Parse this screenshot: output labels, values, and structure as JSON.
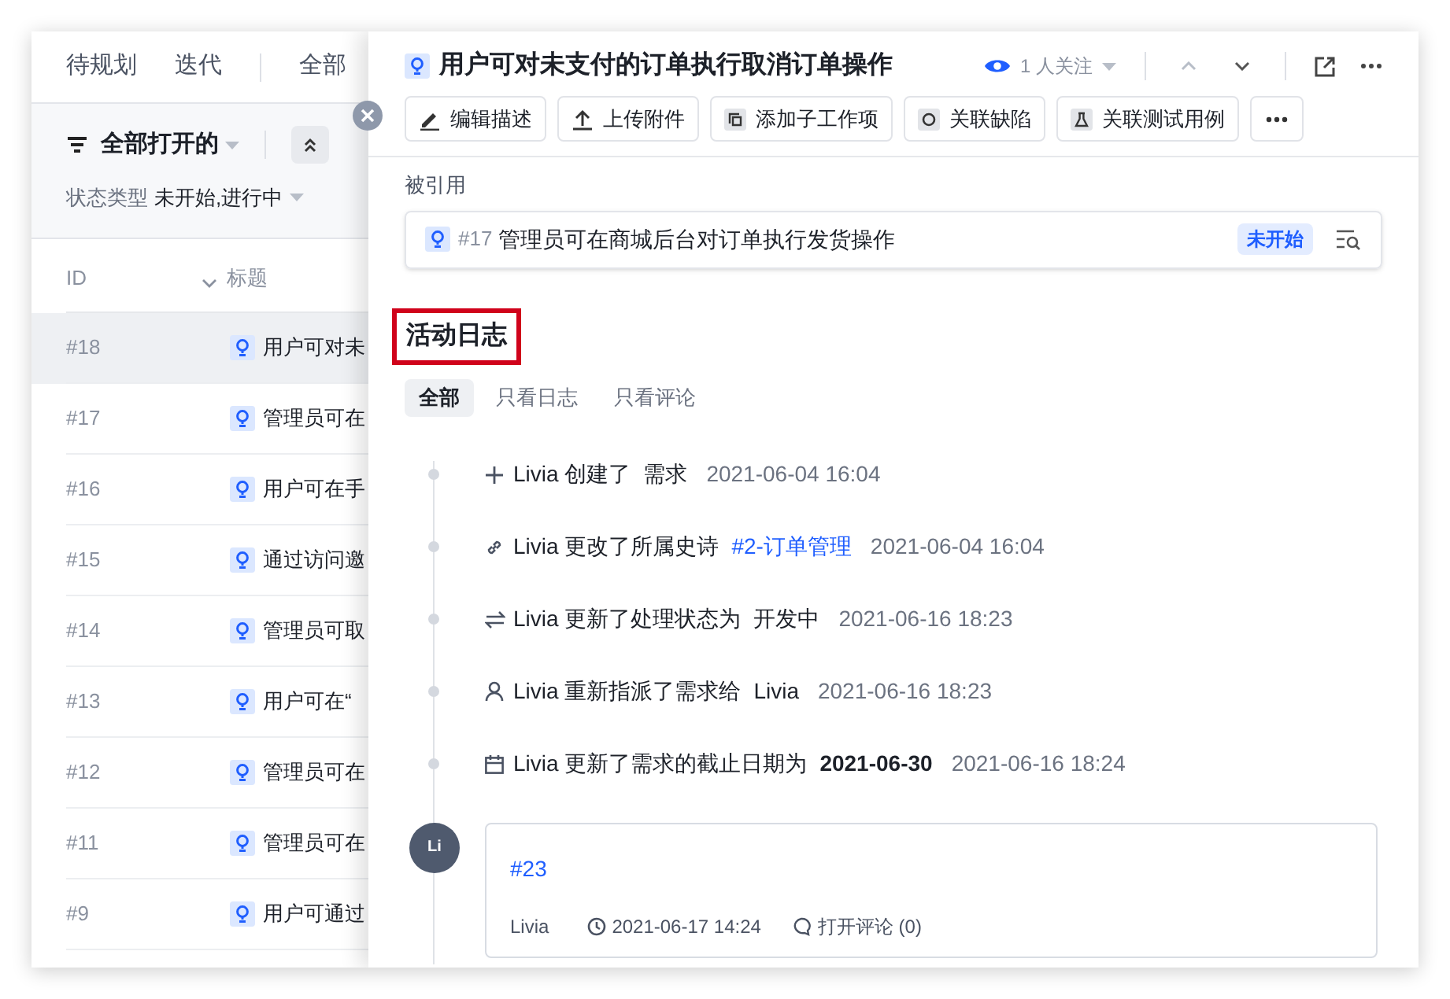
{
  "list_panel": {
    "nav_tabs": [
      "待规划",
      "迭代",
      "全部"
    ],
    "filter": {
      "title": "全部打开的",
      "fields": [
        {
          "label": "状态类型",
          "value": "未开始,进行中"
        }
      ]
    },
    "columns": [
      "ID",
      "标题"
    ],
    "rows": [
      {
        "id": "#18",
        "title": "用户可对未",
        "selected": true
      },
      {
        "id": "#17",
        "title": "管理员可在",
        "selected": false
      },
      {
        "id": "#16",
        "title": "用户可在手",
        "selected": false
      },
      {
        "id": "#15",
        "title": "通过访问邀",
        "selected": false
      },
      {
        "id": "#14",
        "title": "管理员可取",
        "selected": false
      },
      {
        "id": "#13",
        "title": "用户可在“",
        "selected": false
      },
      {
        "id": "#12",
        "title": "管理员可在",
        "selected": false
      },
      {
        "id": "#11",
        "title": "管理员可在",
        "selected": false
      },
      {
        "id": "#9",
        "title": "用户可通过",
        "selected": false
      }
    ]
  },
  "drawer": {
    "title": "用户可对未支付的订单执行取消订单操作",
    "followers": "1 人关注",
    "actions": [
      {
        "kind": "edit",
        "label": "编辑描述"
      },
      {
        "kind": "upload",
        "label": "上传附件"
      },
      {
        "kind": "child",
        "label": "添加子工作项"
      },
      {
        "kind": "bug",
        "label": "关联缺陷"
      },
      {
        "kind": "test",
        "label": "关联测试用例"
      },
      {
        "kind": "more"
      }
    ],
    "references": {
      "label": "被引用",
      "items": [
        {
          "id": "#17",
          "title": "管理员可在商城后台对订单执行发货操作",
          "status": "未开始"
        }
      ]
    },
    "activity": {
      "heading": "活动日志",
      "tabs": [
        {
          "label": "全部",
          "selected": true
        },
        {
          "label": "只看日志",
          "selected": false
        },
        {
          "label": "只看评论",
          "selected": false
        }
      ],
      "entries": [
        {
          "kind": "create",
          "actor": "Livia",
          "action": "创建了",
          "target": "需求",
          "time": "2021-06-04 16:04"
        },
        {
          "kind": "link",
          "actor": "Livia",
          "action": "更改了所属史诗",
          "target": "#2-订单管理",
          "time": "2021-06-04 16:04"
        },
        {
          "kind": "status",
          "actor": "Livia",
          "action": "更新了处理状态为",
          "target": "开发中",
          "time": "2021-06-16 18:23"
        },
        {
          "kind": "assign",
          "actor": "Livia",
          "action": "重新指派了需求给",
          "target": "Livia",
          "time": "2021-06-16 18:23"
        },
        {
          "kind": "date",
          "actor": "Livia",
          "action": "更新了需求的截止日期为",
          "target": "2021-06-30",
          "time": "2021-06-16 18:24"
        }
      ],
      "comment": {
        "avatar": "Li",
        "title": "#23",
        "author": "Livia",
        "time": "2021-06-17 14:24",
        "replies": "打开评论 (0)"
      }
    }
  }
}
